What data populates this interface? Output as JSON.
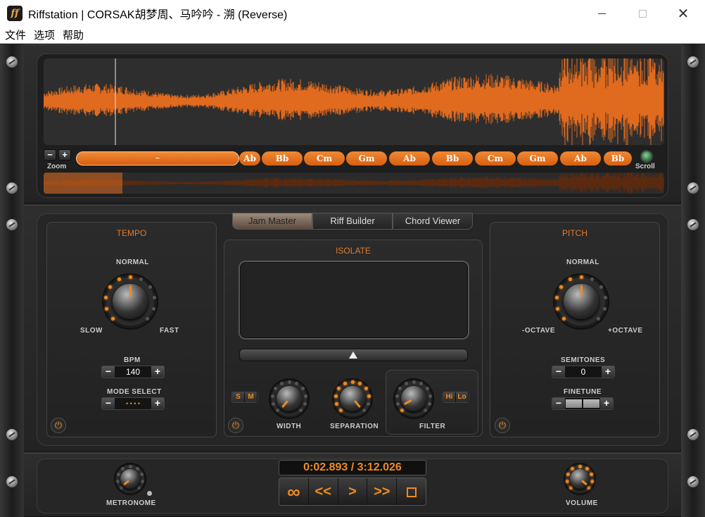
{
  "window": {
    "title": "Riffstation | CORSAK胡梦周、马吟吟 - 溯 (Reverse)",
    "app_icon_text": "ff",
    "minimize": "—",
    "maximize": "☐",
    "close": "✕"
  },
  "menu": [
    "文件",
    "选项",
    "帮助"
  ],
  "waveform": {
    "zoom_label": "Zoom",
    "zoom_minus": "−",
    "zoom_plus": "+",
    "scroll_label": "Scroll",
    "chord_bar_label": "−",
    "chords": [
      "Ab",
      "Bb",
      "Cm",
      "Gm",
      "Ab",
      "Bb",
      "Cm",
      "Gm",
      "Ab",
      "Bb"
    ]
  },
  "tabs": [
    "Jam Master",
    "Riff Builder",
    "Chord Viewer"
  ],
  "tempo": {
    "title": "TEMPO",
    "normal": "NORMAL",
    "slow": "SLOW",
    "fast": "FAST",
    "bpm_label": "BPM",
    "bpm_value": "140",
    "mode_label": "MODE SELECT",
    "mode_value": "• • • •",
    "minus": "−",
    "plus": "+"
  },
  "isolate": {
    "title": "ISOLATE",
    "s_btn": "S",
    "m_btn": "M",
    "width_label": "WIDTH",
    "separation_label": "SEPARATION",
    "filter_label": "FILTER",
    "hi_btn": "Hi",
    "lo_btn": "Lo"
  },
  "pitch": {
    "title": "PITCH",
    "normal": "NORMAL",
    "minus_octave": "-OCTAVE",
    "plus_octave": "+OCTAVE",
    "semitones_label": "SEMITONES",
    "semitones_value": "0",
    "finetune_label": "FINETUNE",
    "minus": "−",
    "plus": "+"
  },
  "transport": {
    "time": "0:02.893 / 3:12.026",
    "loop": "∞",
    "rewind": "<<",
    "play": ">",
    "forward": ">>",
    "metronome_label": "METRONOME",
    "volume_label": "VOLUME"
  },
  "colors": {
    "accent": "#f08a22",
    "waveform": "#e06a1e",
    "panel": "#262626"
  }
}
